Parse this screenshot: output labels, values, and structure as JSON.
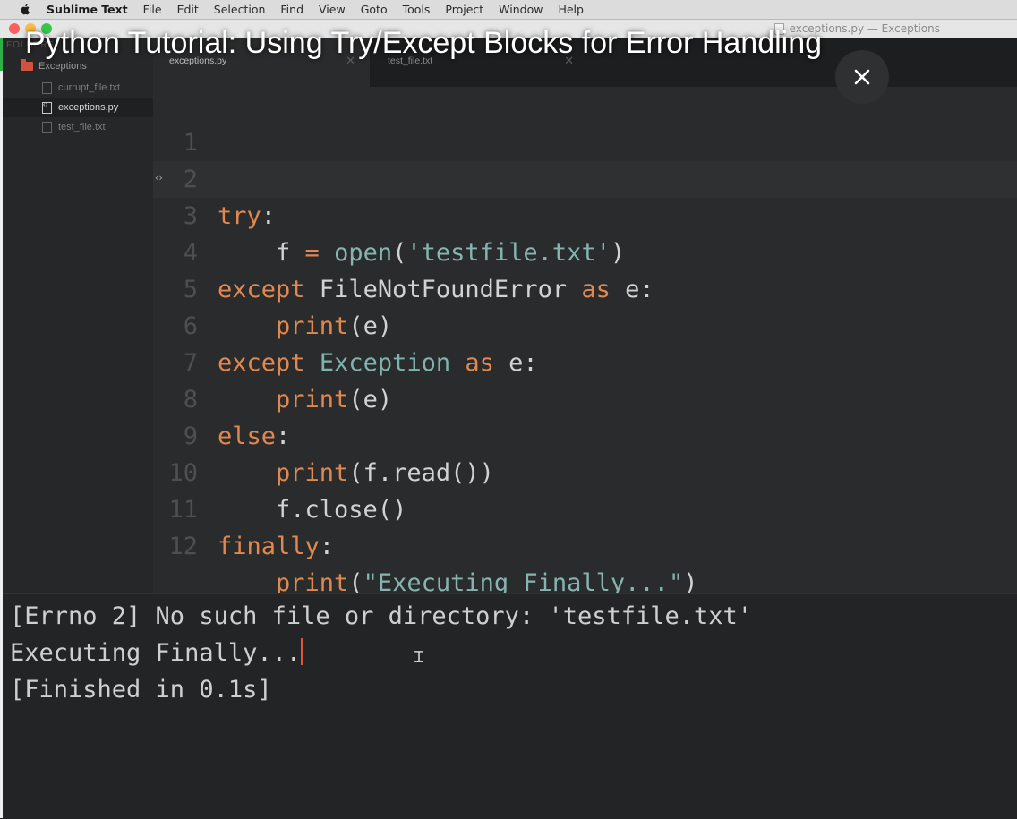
{
  "menubar": {
    "app_name": "Sublime Text",
    "items": [
      "File",
      "Edit",
      "Selection",
      "Find",
      "View",
      "Goto",
      "Tools",
      "Project",
      "Window",
      "Help"
    ]
  },
  "window": {
    "title": "exceptions.py — Exceptions"
  },
  "sidebar": {
    "header": "FOLDERS",
    "folder": "Exceptions",
    "files": [
      "currupt_file.txt",
      "exceptions.py",
      "test_file.txt"
    ],
    "active_file": "exceptions.py"
  },
  "tabs": [
    {
      "label": "exceptions.py",
      "active": true
    },
    {
      "label": "test_file.txt",
      "active": false
    }
  ],
  "editor": {
    "line_numbers": [
      "1",
      "2",
      "3",
      "4",
      "5",
      "6",
      "7",
      "8",
      "9",
      "10",
      "11",
      "12"
    ],
    "current_line": "3",
    "lines": [
      "",
      "try:",
      "    f = open('testfile.txt')",
      "except FileNotFoundError as e:",
      "    print(e)",
      "except Exception as e:",
      "    print(e)",
      "else:",
      "    print(f.read())",
      "    f.close()",
      "finally:",
      "    print(\"Executing Finally...\")"
    ]
  },
  "console": {
    "lines": [
      "[Errno 2] No such file or directory: 'testfile.txt'",
      "Executing Finally...",
      "[Finished in 0.1s]"
    ]
  },
  "overlay": {
    "video_title": "Python Tutorial: Using Try/Except Blocks for Error Handling",
    "close_icon": "close-icon"
  },
  "colors": {
    "keyword": "#e0884f",
    "string": "#86b4b0",
    "class_name": "#7fb3ad",
    "editor_bg": "#2a2b2c",
    "cursor": "#e0563c"
  }
}
